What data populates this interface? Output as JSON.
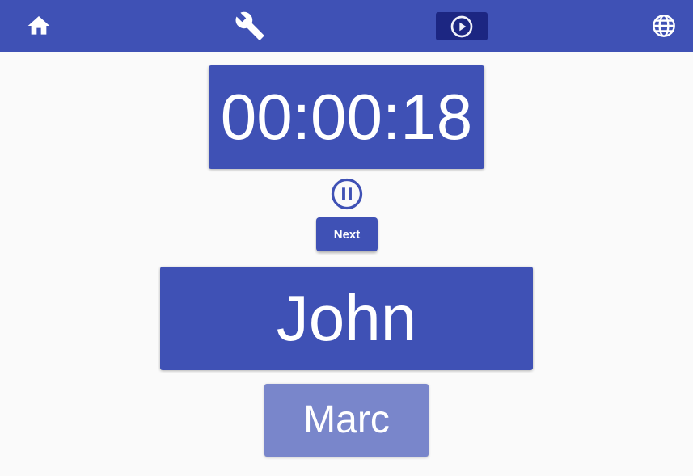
{
  "toolbar": {
    "home_icon": "home-icon",
    "settings_icon": "wrench-icon",
    "presentation_icon": "play-circle-icon",
    "language_icon": "globe-icon",
    "active_item": "presentation"
  },
  "timer": {
    "value": "00:00:18",
    "pause_icon": "pause-circle-icon"
  },
  "controls": {
    "next_label": "Next"
  },
  "speakers": {
    "current": "John",
    "up_next": "Marc"
  },
  "colors": {
    "primary": "#3f51b5",
    "primary_dark": "#1a237e",
    "primary_light": "#7986cb",
    "background": "#fafafa"
  }
}
